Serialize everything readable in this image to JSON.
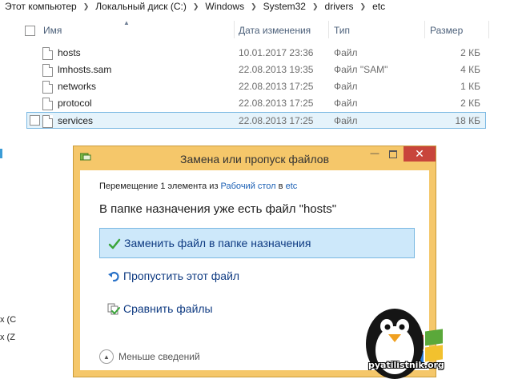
{
  "breadcrumb": [
    "Этот компьютер",
    "Локальный диск (C:)",
    "Windows",
    "System32",
    "drivers",
    "etc"
  ],
  "left_fragments": [
    "x (C",
    "x (Z"
  ],
  "columns": {
    "name": "Имя",
    "modified": "Дата изменения",
    "type": "Тип",
    "size": "Размер"
  },
  "files": [
    {
      "name": "hosts",
      "date": "10.01.2017 23:36",
      "type": "Файл",
      "size": "2 КБ",
      "selected": false
    },
    {
      "name": "lmhosts.sam",
      "date": "22.08.2013 19:35",
      "type": "Файл \"SAM\"",
      "size": "4 КБ",
      "selected": false
    },
    {
      "name": "networks",
      "date": "22.08.2013 17:25",
      "type": "Файл",
      "size": "1 КБ",
      "selected": false
    },
    {
      "name": "protocol",
      "date": "22.08.2013 17:25",
      "type": "Файл",
      "size": "2 КБ",
      "selected": false
    },
    {
      "name": "services",
      "date": "22.08.2013 17:25",
      "type": "Файл",
      "size": "18 КБ",
      "selected": true
    }
  ],
  "dialog": {
    "title": "Замена или пропуск файлов",
    "minimize": "—",
    "close": "✕",
    "move_prefix": "Перемещение 1 элемента из ",
    "source_link": "Рабочий стол",
    "move_middle": " в ",
    "dest_link": "etc",
    "headline": "В папке назначения уже есть файл \"hosts\"",
    "options": [
      {
        "label": "Заменить файл в папке назначения",
        "icon": "checkmark-icon",
        "highlighted": true
      },
      {
        "label": "Пропустить этот файл",
        "icon": "skip-arrow-icon",
        "highlighted": false
      },
      {
        "label": "Сравнить файлы",
        "icon": "compare-files-icon",
        "highlighted": false
      }
    ],
    "details_label": "Меньше сведений"
  },
  "watermark": {
    "text": "pyatilistnik.org"
  },
  "colors": {
    "dialog_frame": "#f5c76a",
    "close_button": "#c8453b",
    "link": "#1a5fb4",
    "option_text": "#0f3b82",
    "selection": "#e5f3fb"
  }
}
